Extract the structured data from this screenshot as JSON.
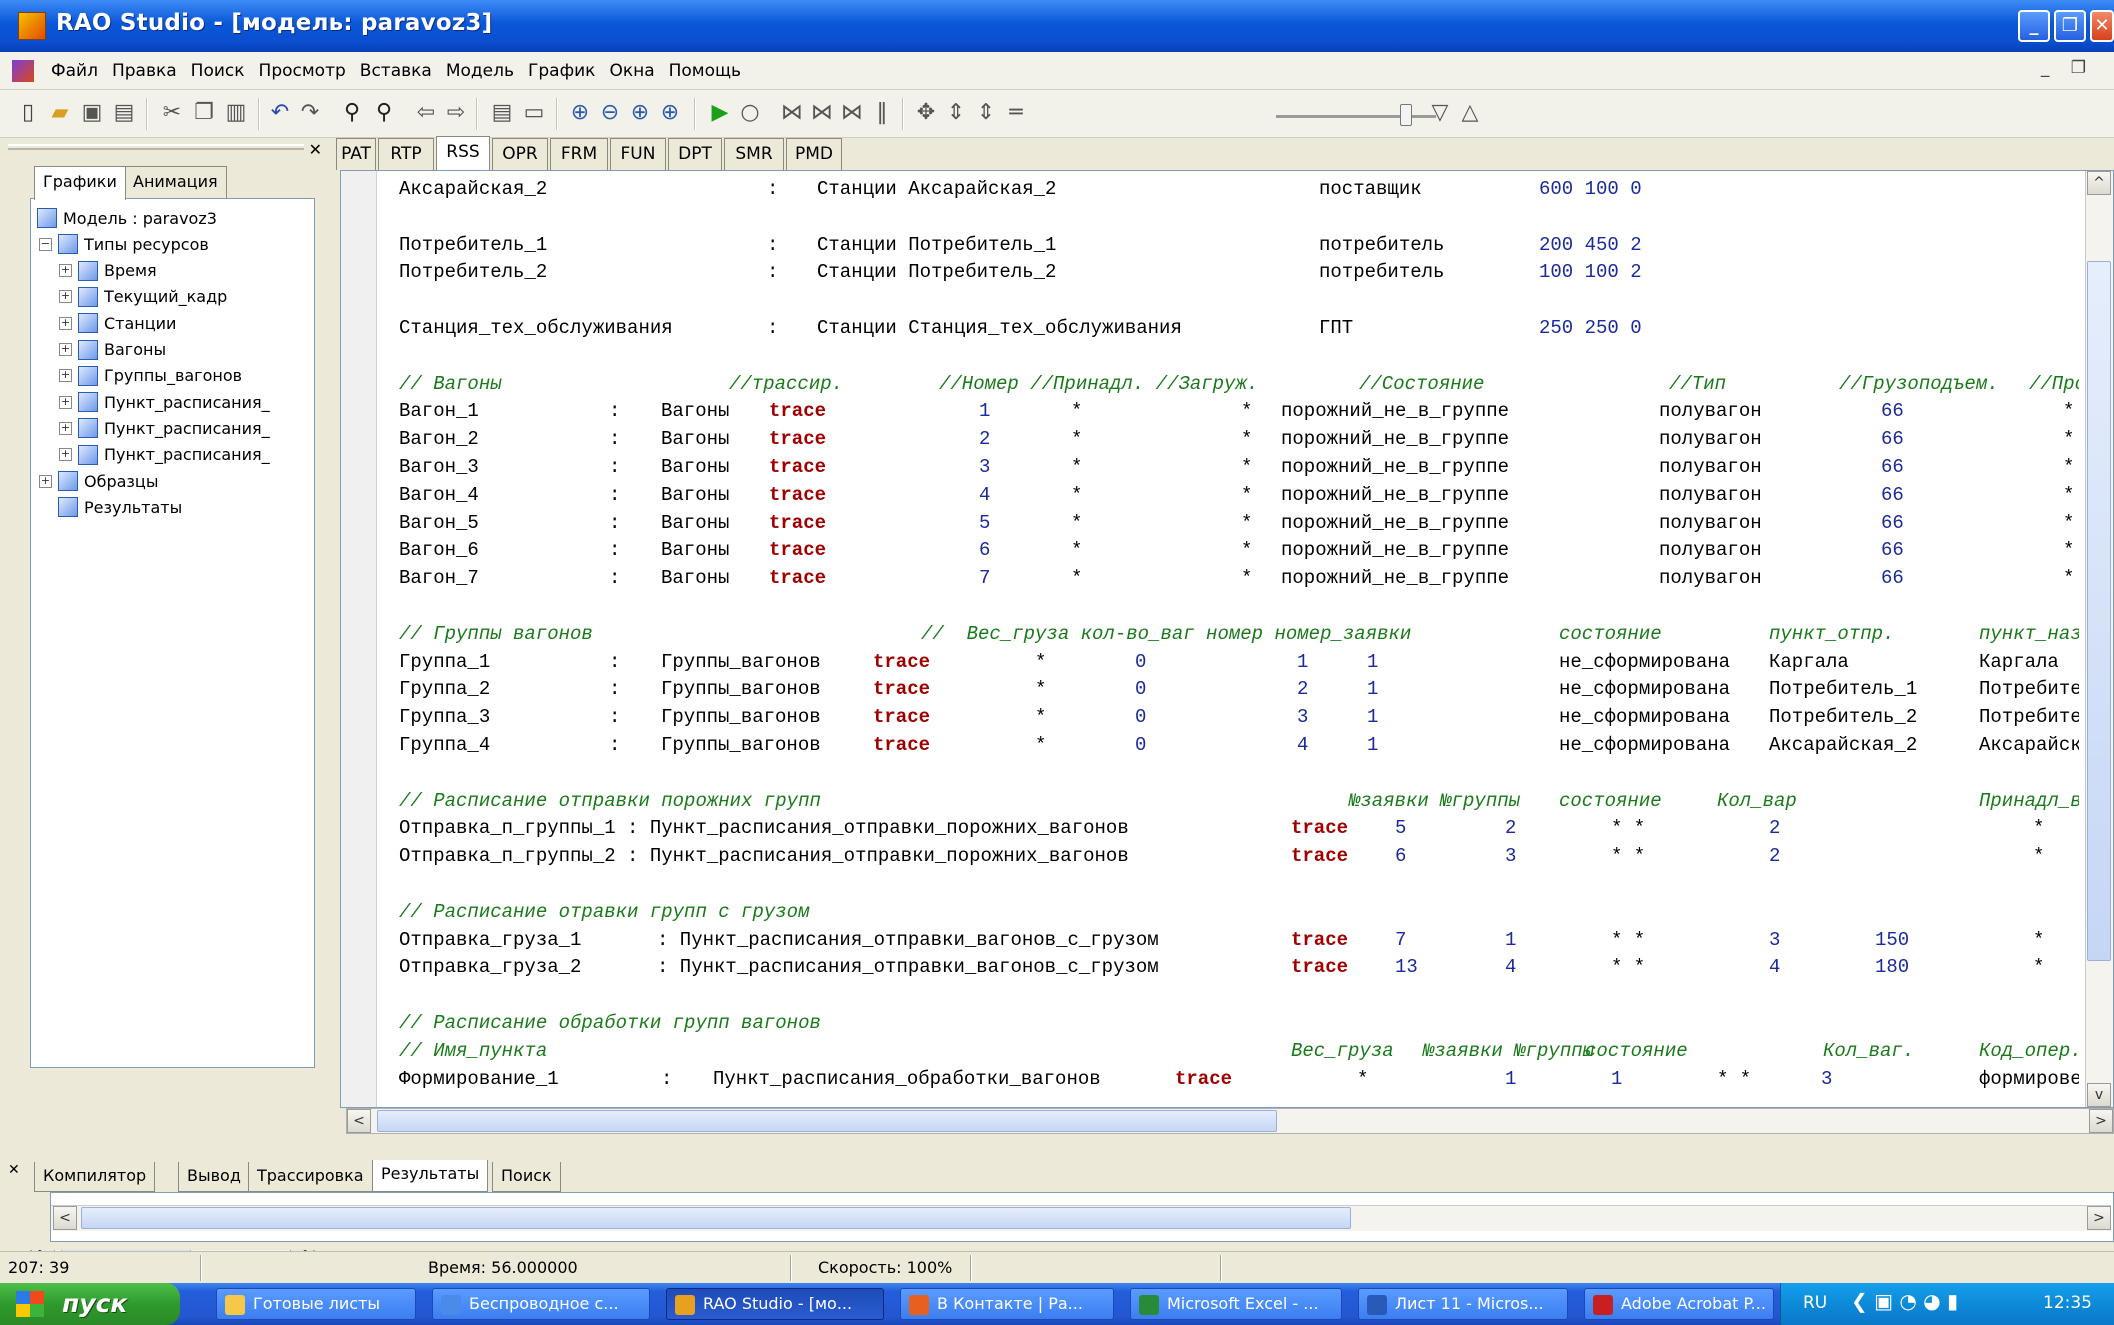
{
  "window": {
    "title": "RAO Studio - [модель: paravoz3]",
    "buttons": [
      "_",
      "❐",
      "✕"
    ]
  },
  "menu": {
    "items": [
      "Файл",
      "Правка",
      "Поиск",
      "Просмотр",
      "Вставка",
      "Модель",
      "График",
      "Окна",
      "Помощь"
    ],
    "mdi_controls": "_ ❐"
  },
  "toolbar": {
    "icons": [
      "new-file-icon",
      "open-folder-icon",
      "save-icon",
      "save-all-icon",
      "cut-icon",
      "copy-icon",
      "paste-icon",
      "undo-icon",
      "redo-icon",
      "find-icon",
      "find-next-icon",
      "back-icon",
      "forward-icon",
      "toggle-panel-icon",
      "toggle-output-icon",
      "zoom-in-icon",
      "zoom-out-icon",
      "zoom-fit-icon",
      "zoom-reset-icon",
      "run-icon",
      "stop-icon",
      "step-icon",
      "pause-icon",
      "play-icon",
      "down-icon",
      "up-icon"
    ]
  },
  "left_panel": {
    "tabs": [
      "Графики",
      "Анимация"
    ],
    "tree": [
      {
        "label": "Модель : paravoz3",
        "level": 0,
        "toggle": ""
      },
      {
        "label": "Типы ресурсов",
        "level": 1,
        "toggle": "−"
      },
      {
        "label": "Время",
        "level": 2,
        "toggle": "+"
      },
      {
        "label": "Текущий_кадр",
        "level": 2,
        "toggle": "+"
      },
      {
        "label": "Станции",
        "level": 2,
        "toggle": "+"
      },
      {
        "label": "Вагоны",
        "level": 2,
        "toggle": "+"
      },
      {
        "label": "Группы_вагонов",
        "level": 2,
        "toggle": "+"
      },
      {
        "label": "Пункт_расписания_",
        "level": 2,
        "toggle": "+"
      },
      {
        "label": "Пункт_расписания_",
        "level": 2,
        "toggle": "+"
      },
      {
        "label": "Пункт_расписания_",
        "level": 2,
        "toggle": "+"
      },
      {
        "label": "Образцы",
        "level": 1,
        "toggle": "+"
      },
      {
        "label": "Результаты",
        "level": 1,
        "toggle": ""
      }
    ]
  },
  "editor": {
    "tabs": [
      "PAT",
      "RTP",
      "RSS",
      "OPR",
      "FRM",
      "FUN",
      "DPT",
      "SMR",
      "PMD"
    ],
    "active_tab": "RSS",
    "lines": [
      [
        [
          "Аксарайская_2",
          0,
          ""
        ],
        [
          ":",
          368,
          ""
        ],
        [
          "Станции Аксарайская_2",
          418,
          ""
        ],
        [
          "поставщик",
          920,
          ""
        ],
        [
          "600 100 0",
          1140,
          "nm"
        ]
      ],
      [],
      [
        [
          "Потребитель_1",
          0,
          ""
        ],
        [
          ":",
          368,
          ""
        ],
        [
          "Станции Потребитель_1",
          418,
          ""
        ],
        [
          "потребитель",
          920,
          ""
        ],
        [
          "200 450 2",
          1140,
          "nm"
        ]
      ],
      [
        [
          "Потребитель_2",
          0,
          ""
        ],
        [
          ":",
          368,
          ""
        ],
        [
          "Станции Потребитель_2",
          418,
          ""
        ],
        [
          "потребитель",
          920,
          ""
        ],
        [
          "100 100 2",
          1140,
          "nm"
        ]
      ],
      [],
      [
        [
          "Станция_тех_обслуживания",
          0,
          ""
        ],
        [
          ":",
          368,
          ""
        ],
        [
          "Станции Станция_тех_обслуживания",
          418,
          ""
        ],
        [
          "ГПТ",
          920,
          ""
        ],
        [
          "250 250 0",
          1140,
          "nm"
        ]
      ],
      [],
      [
        [
          "// Вагоны",
          0,
          "cm"
        ],
        [
          "//трассир.",
          330,
          "cm"
        ],
        [
          "//Номер //Принадл. //Загруж.",
          540,
          "cm"
        ],
        [
          "//Состояние",
          960,
          "cm"
        ],
        [
          "//Тип",
          1270,
          "cm"
        ],
        [
          "//Грузоподъем.",
          1440,
          "cm"
        ],
        [
          "//Про",
          1630,
          "cm"
        ]
      ],
      [
        [
          "Вагон_1",
          0,
          ""
        ],
        [
          ":",
          210,
          ""
        ],
        [
          "Вагоны",
          262,
          ""
        ],
        [
          "trace",
          370,
          "kw"
        ],
        [
          "1",
          580,
          "nm"
        ],
        [
          "*",
          672,
          ""
        ],
        [
          "*",
          842,
          ""
        ],
        [
          "порожний_не_в_группе",
          882,
          ""
        ],
        [
          "полувагон",
          1260,
          ""
        ],
        [
          "66",
          1482,
          "nm"
        ],
        [
          "*",
          1664,
          ""
        ]
      ],
      [
        [
          "Вагон_2",
          0,
          ""
        ],
        [
          ":",
          210,
          ""
        ],
        [
          "Вагоны",
          262,
          ""
        ],
        [
          "trace",
          370,
          "kw"
        ],
        [
          "2",
          580,
          "nm"
        ],
        [
          "*",
          672,
          ""
        ],
        [
          "*",
          842,
          ""
        ],
        [
          "порожний_не_в_группе",
          882,
          ""
        ],
        [
          "полувагон",
          1260,
          ""
        ],
        [
          "66",
          1482,
          "nm"
        ],
        [
          "*",
          1664,
          ""
        ]
      ],
      [
        [
          "Вагон_3",
          0,
          ""
        ],
        [
          ":",
          210,
          ""
        ],
        [
          "Вагоны",
          262,
          ""
        ],
        [
          "trace",
          370,
          "kw"
        ],
        [
          "3",
          580,
          "nm"
        ],
        [
          "*",
          672,
          ""
        ],
        [
          "*",
          842,
          ""
        ],
        [
          "порожний_не_в_группе",
          882,
          ""
        ],
        [
          "полувагон",
          1260,
          ""
        ],
        [
          "66",
          1482,
          "nm"
        ],
        [
          "*",
          1664,
          ""
        ]
      ],
      [
        [
          "Вагон_4",
          0,
          ""
        ],
        [
          ":",
          210,
          ""
        ],
        [
          "Вагоны",
          262,
          ""
        ],
        [
          "trace",
          370,
          "kw"
        ],
        [
          "4",
          580,
          "nm"
        ],
        [
          "*",
          672,
          ""
        ],
        [
          "*",
          842,
          ""
        ],
        [
          "порожний_не_в_группе",
          882,
          ""
        ],
        [
          "полувагон",
          1260,
          ""
        ],
        [
          "66",
          1482,
          "nm"
        ],
        [
          "*",
          1664,
          ""
        ]
      ],
      [
        [
          "Вагон_5",
          0,
          ""
        ],
        [
          ":",
          210,
          ""
        ],
        [
          "Вагоны",
          262,
          ""
        ],
        [
          "trace",
          370,
          "kw"
        ],
        [
          "5",
          580,
          "nm"
        ],
        [
          "*",
          672,
          ""
        ],
        [
          "*",
          842,
          ""
        ],
        [
          "порожний_не_в_группе",
          882,
          ""
        ],
        [
          "полувагон",
          1260,
          ""
        ],
        [
          "66",
          1482,
          "nm"
        ],
        [
          "*",
          1664,
          ""
        ]
      ],
      [
        [
          "Вагон_6",
          0,
          ""
        ],
        [
          ":",
          210,
          ""
        ],
        [
          "Вагоны",
          262,
          ""
        ],
        [
          "trace",
          370,
          "kw"
        ],
        [
          "6",
          580,
          "nm"
        ],
        [
          "*",
          672,
          ""
        ],
        [
          "*",
          842,
          ""
        ],
        [
          "порожний_не_в_группе",
          882,
          ""
        ],
        [
          "полувагон",
          1260,
          ""
        ],
        [
          "66",
          1482,
          "nm"
        ],
        [
          "*",
          1664,
          ""
        ]
      ],
      [
        [
          "Вагон_7",
          0,
          ""
        ],
        [
          ":",
          210,
          ""
        ],
        [
          "Вагоны",
          262,
          ""
        ],
        [
          "trace",
          370,
          "kw"
        ],
        [
          "7",
          580,
          "nm"
        ],
        [
          "*",
          672,
          ""
        ],
        [
          "*",
          842,
          ""
        ],
        [
          "порожний_не_в_группе",
          882,
          ""
        ],
        [
          "полувагон",
          1260,
          ""
        ],
        [
          "66",
          1482,
          "nm"
        ],
        [
          "*",
          1664,
          ""
        ]
      ],
      [],
      [
        [
          "// Группы вагонов",
          0,
          "cm"
        ],
        [
          "//  Вес_груза кол-во_ваг номер номер_заявки",
          522,
          "cm"
        ],
        [
          "состояние",
          1160,
          "cm"
        ],
        [
          "пункт_отпр.",
          1370,
          "cm"
        ],
        [
          "пункт_наз",
          1580,
          "cm"
        ]
      ],
      [
        [
          "Группа_1",
          0,
          ""
        ],
        [
          ":",
          210,
          ""
        ],
        [
          "Группы_вагонов",
          262,
          ""
        ],
        [
          "trace",
          474,
          "kw"
        ],
        [
          "*",
          636,
          ""
        ],
        [
          "0",
          736,
          "nm"
        ],
        [
          "1",
          898,
          "nm"
        ],
        [
          "1",
          968,
          "nm"
        ],
        [
          "не_сформирована",
          1160,
          ""
        ],
        [
          "Каргала",
          1370,
          ""
        ],
        [
          "Каргала",
          1580,
          ""
        ]
      ],
      [
        [
          "Группа_2",
          0,
          ""
        ],
        [
          ":",
          210,
          ""
        ],
        [
          "Группы_вагонов",
          262,
          ""
        ],
        [
          "trace",
          474,
          "kw"
        ],
        [
          "*",
          636,
          ""
        ],
        [
          "0",
          736,
          "nm"
        ],
        [
          "2",
          898,
          "nm"
        ],
        [
          "1",
          968,
          "nm"
        ],
        [
          "не_сформирована",
          1160,
          ""
        ],
        [
          "Потребитель_1",
          1370,
          ""
        ],
        [
          "Потребите",
          1580,
          ""
        ]
      ],
      [
        [
          "Группа_3",
          0,
          ""
        ],
        [
          ":",
          210,
          ""
        ],
        [
          "Группы_вагонов",
          262,
          ""
        ],
        [
          "trace",
          474,
          "kw"
        ],
        [
          "*",
          636,
          ""
        ],
        [
          "0",
          736,
          "nm"
        ],
        [
          "3",
          898,
          "nm"
        ],
        [
          "1",
          968,
          "nm"
        ],
        [
          "не_сформирована",
          1160,
          ""
        ],
        [
          "Потребитель_2",
          1370,
          ""
        ],
        [
          "Потребите",
          1580,
          ""
        ]
      ],
      [
        [
          "Группа_4",
          0,
          ""
        ],
        [
          ":",
          210,
          ""
        ],
        [
          "Группы_вагонов",
          262,
          ""
        ],
        [
          "trace",
          474,
          "kw"
        ],
        [
          "*",
          636,
          ""
        ],
        [
          "0",
          736,
          "nm"
        ],
        [
          "4",
          898,
          "nm"
        ],
        [
          "1",
          968,
          "nm"
        ],
        [
          "не_сформирована",
          1160,
          ""
        ],
        [
          "Аксарайская_2",
          1370,
          ""
        ],
        [
          "Аксарайск",
          1580,
          ""
        ]
      ],
      [],
      [
        [
          "// Расписание отправки порожних групп",
          0,
          "cm"
        ],
        [
          "№заявки №группы",
          950,
          "cm"
        ],
        [
          "состояние",
          1160,
          "cm"
        ],
        [
          "Кол_вар",
          1318,
          "cm"
        ],
        [
          "Принадл_в",
          1580,
          "cm"
        ]
      ],
      [
        [
          "Отправка_п_группы_1 : Пункт_расписания_отправки_порожних_вагонов",
          0,
          ""
        ],
        [
          "trace",
          892,
          "kw"
        ],
        [
          "5",
          996,
          "nm"
        ],
        [
          "2",
          1106,
          "nm"
        ],
        [
          "* *",
          1212,
          ""
        ],
        [
          "2",
          1370,
          "nm"
        ],
        [
          "*",
          1634,
          ""
        ]
      ],
      [
        [
          "Отправка_п_группы_2 : Пункт_расписания_отправки_порожних_вагонов",
          0,
          ""
        ],
        [
          "trace",
          892,
          "kw"
        ],
        [
          "6",
          996,
          "nm"
        ],
        [
          "3",
          1106,
          "nm"
        ],
        [
          "* *",
          1212,
          ""
        ],
        [
          "2",
          1370,
          "nm"
        ],
        [
          "*",
          1634,
          ""
        ]
      ],
      [],
      [
        [
          "// Расписание отравки групп с грузом",
          0,
          "cm"
        ]
      ],
      [
        [
          "Отправка_груза_1",
          0,
          ""
        ],
        [
          ": Пункт_расписания_отправки_вагонов_с_грузом",
          258,
          ""
        ],
        [
          "trace",
          892,
          "kw"
        ],
        [
          "7",
          996,
          "nm"
        ],
        [
          "1",
          1106,
          "nm"
        ],
        [
          "* *",
          1212,
          ""
        ],
        [
          "3",
          1370,
          "nm"
        ],
        [
          "150",
          1476,
          "nm"
        ],
        [
          "*",
          1634,
          ""
        ]
      ],
      [
        [
          "Отправка_груза_2",
          0,
          ""
        ],
        [
          ": Пункт_расписания_отправки_вагонов_с_грузом",
          258,
          ""
        ],
        [
          "trace",
          892,
          "kw"
        ],
        [
          "13",
          996,
          "nm"
        ],
        [
          "4",
          1106,
          "nm"
        ],
        [
          "* *",
          1212,
          ""
        ],
        [
          "4",
          1370,
          "nm"
        ],
        [
          "180",
          1476,
          "nm"
        ],
        [
          "*",
          1634,
          ""
        ]
      ],
      [],
      [
        [
          "// Расписание обработки групп вагонов",
          0,
          "cm"
        ]
      ],
      [
        [
          "// Имя_пункта",
          0,
          "cm"
        ],
        [
          "Вес_груза",
          892,
          "cm"
        ],
        [
          "№заявки №группы",
          1024,
          "cm"
        ],
        [
          "состояние",
          1186,
          "cm"
        ],
        [
          "Кол_ваг.",
          1424,
          "cm"
        ],
        [
          "Код_опер.",
          1580,
          "cm"
        ]
      ],
      [
        [
          "Формирование_1",
          0,
          ""
        ],
        [
          ":",
          262,
          ""
        ],
        [
          "Пункт_расписания_обработки_вагонов",
          314,
          ""
        ],
        [
          "trace",
          776,
          "kw"
        ],
        [
          "*",
          958,
          ""
        ],
        [
          "1",
          1106,
          "nm"
        ],
        [
          "1",
          1212,
          "nm"
        ],
        [
          "* *",
          1318,
          ""
        ],
        [
          "3",
          1422,
          "nm"
        ],
        [
          "формирове",
          1580,
          ""
        ]
      ]
    ]
  },
  "bottom_panel": {
    "tabs": [
      "Компилятор",
      "Вывод",
      "Трассировка",
      "Результаты",
      "Поиск"
    ],
    "active_tab": "Результаты"
  },
  "status": {
    "position": "207: 39",
    "time": "Время: 56.000000",
    "speed": "Скорость: 100%"
  },
  "taskbar": {
    "start": "пуск",
    "tasks": [
      {
        "label": "Готовые листы",
        "color": "#f5c84a"
      },
      {
        "label": "Беспроводное с...",
        "color": "#4a8ae8"
      },
      {
        "label": "RAO Studio - [мо...",
        "color": "#e8a020"
      },
      {
        "label": "В Контакте | Ра...",
        "color": "#e86020"
      },
      {
        "label": "Microsoft Excel - ...",
        "color": "#2a8a3a"
      },
      {
        "label": "Лист 11 - Micros...",
        "color": "#2a5ab8"
      },
      {
        "label": "Adobe Acrobat P...",
        "color": "#c82020"
      }
    ],
    "lang": "RU",
    "clock": "12:35"
  }
}
